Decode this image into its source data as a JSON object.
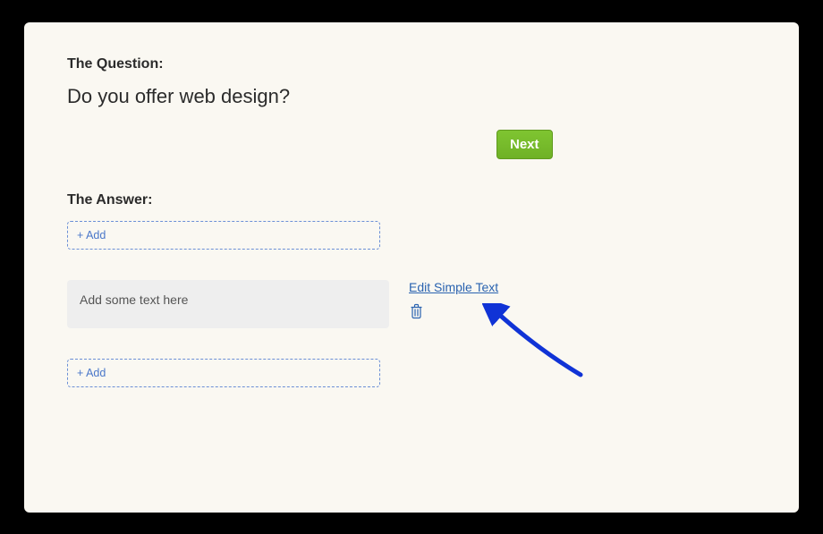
{
  "question": {
    "section_label": "The Question:",
    "text": "Do you offer web design?",
    "next_button": "Next"
  },
  "answer": {
    "section_label": "The Answer:",
    "add_label": "+ Add",
    "text_block_placeholder": "Add some text here",
    "edit_link": "Edit Simple Text"
  },
  "colors": {
    "accent_green": "#76b82a",
    "link_blue": "#2a63b0",
    "dashed_border": "#6b8fd6",
    "annotation_arrow": "#1033d6"
  }
}
